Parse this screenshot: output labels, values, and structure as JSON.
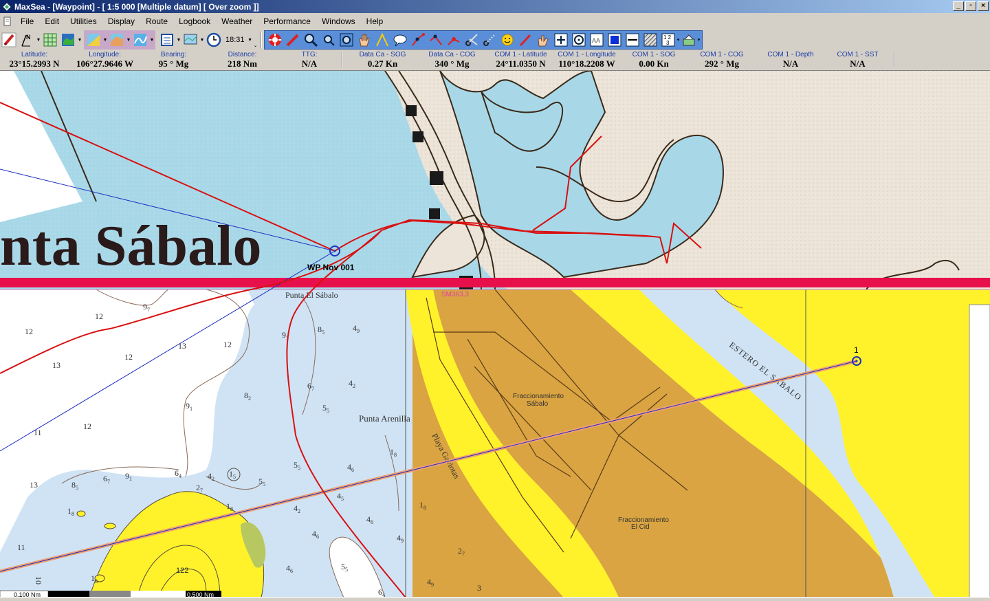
{
  "window": {
    "title": "MaxSea - [Waypoint] - [ 1:5 000 [Multiple datum]  [ Over zoom ]]",
    "minimize_glyph": "_",
    "maximize_glyph": "▫",
    "close_glyph": "×"
  },
  "menu": {
    "items": [
      "File",
      "Edit",
      "Utilities",
      "Display",
      "Route",
      "Logbook",
      "Weather",
      "Performance",
      "Windows",
      "Help"
    ],
    "accel": [
      "F",
      "E",
      "U",
      "D",
      "R",
      "L",
      "W",
      "P",
      "",
      "H"
    ]
  },
  "toolbar": {
    "time": "18:31",
    "icons": [
      "pencil-icon",
      "north-arrow-icon",
      "grid-icon",
      "globe-icon",
      "chart-layers-icon",
      "chart-overlay-icon",
      "route-curve-icon",
      "waypoint-list-icon",
      "screen-icon",
      "clock-icon",
      "lifebuoy-icon",
      "route-pen-icon",
      "zoom-in-icon",
      "zoom-out-icon",
      "zoom-fit-icon",
      "hand-icon",
      "angle-icon",
      "bubble-icon",
      "route-create-icon",
      "route-edit-icon",
      "route-nodes-icon",
      "scissors-icon",
      "scissors-dashed-icon",
      "smiley-icon",
      "edit-pen-icon",
      "eraser-hand-icon",
      "plus-icon",
      "circle-target-icon",
      "text-aa-icon",
      "fill-color-icon",
      "line-style-icon",
      "hatch-icon",
      "numbers-icon",
      "layers-icon"
    ],
    "accent": "#5a8ed8"
  },
  "databar": {
    "fields": [
      {
        "label": "Latitude:",
        "value": "23°15.2993 N"
      },
      {
        "label": "Longitude:",
        "value": "106°27.9646 W"
      },
      {
        "label": "Bearing:",
        "value": "95 ° Mg"
      },
      {
        "label": "Distance:",
        "value": "218 Nm"
      },
      {
        "label": "TTG:",
        "value": "N/A"
      },
      {
        "label": "Data Ca - SOG",
        "value": "0.27 Kn"
      },
      {
        "label": "Data Ca - COG",
        "value": "340 ° Mg"
      },
      {
        "label": "COM 1 - Latitude",
        "value": "24°11.0350 N"
      },
      {
        "label": "COM 1 - Longitude",
        "value": "110°18.2208 W"
      },
      {
        "label": "COM 1 - SOG",
        "value": "0.00 Kn"
      },
      {
        "label": "COM 1 - COG",
        "value": "292 ° Mg"
      },
      {
        "label": "COM 1 - Depth",
        "value": "N/A"
      },
      {
        "label": "COM 1 - SST",
        "value": "N/A"
      }
    ]
  },
  "map": {
    "upper_place_name": "nta  Sábalo",
    "waypoint_label": "WP Nov 001",
    "point_el_sabalo": "Punta El Sábalo",
    "chart_id": "SM363.3",
    "punta_arenilla": "Punta Arenilla",
    "playa_gaviotas": "Playa Gaviotas",
    "estero": "ESTERO EL SABALO",
    "fracc1_line1": "Fraccionamiento",
    "fracc1_line2": "Sábalo",
    "fracc2_line1": "Fraccionamiento",
    "fracc2_line2": "El Cid",
    "waypoint_1": "1",
    "height_122": "122",
    "scale_1": "0.100 Nm",
    "scale_2": "0.500 Nm",
    "depths_plain": [
      "12",
      "12",
      "13",
      "12",
      "12",
      "13",
      "12",
      "11",
      "13",
      "11",
      "3",
      "10"
    ],
    "colors": {
      "water_light": "#a8d8e8",
      "water_pale": "#cfe3f4",
      "land_yellow": "#fff22a",
      "land_orange": "#d9a441",
      "paper": "#ece4d8",
      "track_red": "#d81010",
      "route_blue": "#2030c0",
      "border_magenta": "#e8104a"
    }
  }
}
